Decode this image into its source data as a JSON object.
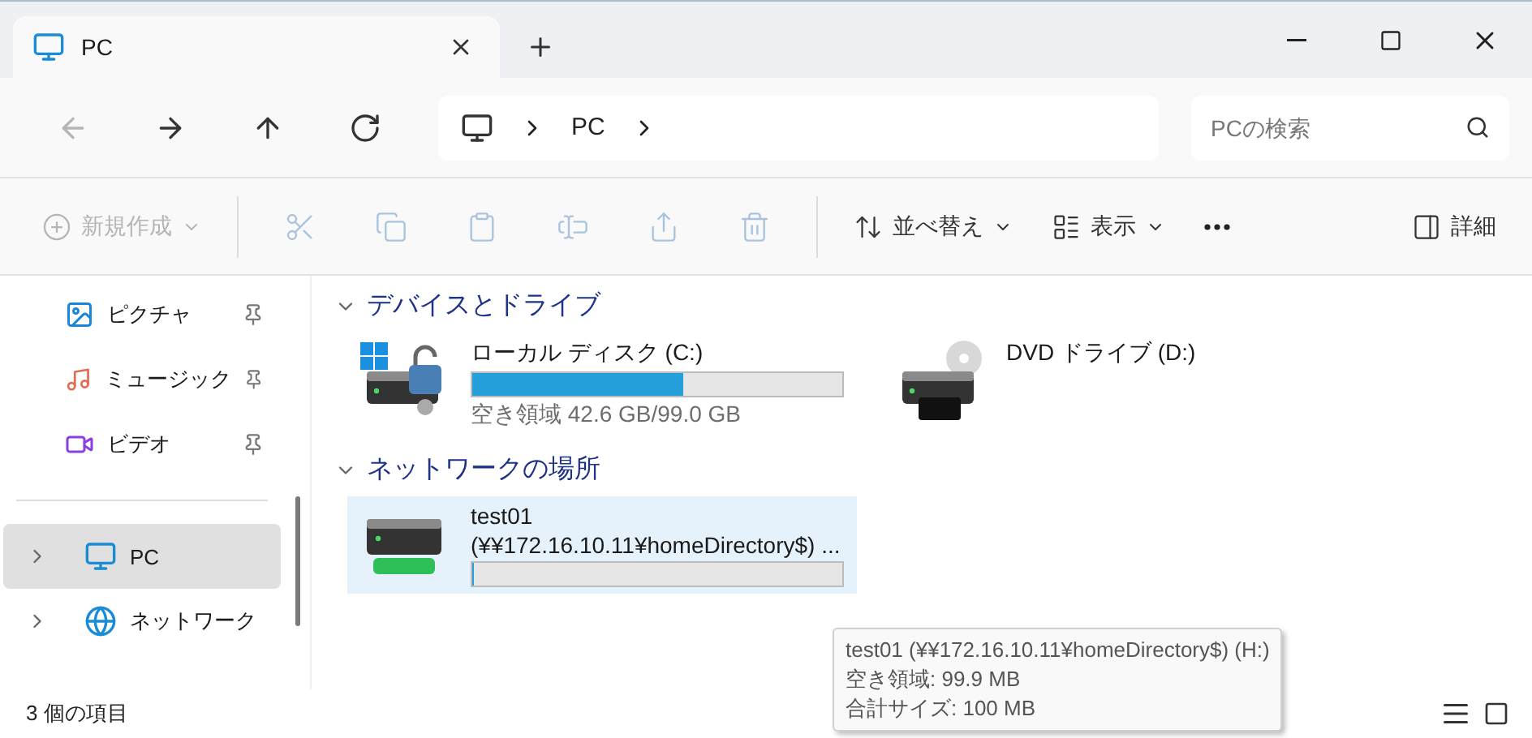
{
  "window": {
    "tab": {
      "title": "PC",
      "selected": true
    }
  },
  "address": {
    "path": [
      "PC"
    ],
    "search": {
      "placeholder": "PCの検索"
    },
    "nav": [
      {
        "disabled": true
      },
      {
        "disabled": false
      },
      {
        "disabled": false
      },
      {
        "disabled": false
      }
    ]
  },
  "toolbar": {
    "items": [
      {
        "kind": "menu",
        "label": "新規作成",
        "disabled": true
      },
      {
        "kind": "separator"
      },
      {
        "kind": "icon",
        "disabled": true
      },
      {
        "kind": "icon",
        "disabled": true
      },
      {
        "kind": "icon",
        "disabled": true
      },
      {
        "kind": "icon",
        "disabled": true
      },
      {
        "kind": "icon",
        "disabled": true
      },
      {
        "kind": "icon",
        "disabled": true
      },
      {
        "kind": "separator"
      },
      {
        "kind": "menu",
        "label": "並べ替え",
        "disabled": false
      },
      {
        "kind": "menu",
        "label": "表示",
        "disabled": false
      },
      {
        "kind": "more",
        "disabled": false
      }
    ],
    "details": {
      "label": "詳細"
    }
  },
  "sidebar": {
    "items": [
      {
        "kind": "pinned",
        "label": "ピクチャ",
        "selected": false
      },
      {
        "kind": "pinned",
        "label": "ミュージック",
        "selected": false
      },
      {
        "kind": "pinned",
        "label": "ビデオ",
        "selected": false
      },
      {
        "kind": "divider"
      },
      {
        "kind": "expandable",
        "label": "PC",
        "selected": true
      },
      {
        "kind": "expandable",
        "label": "ネットワーク",
        "selected": false
      }
    ]
  },
  "sections": [
    {
      "title": "デバイスとドライブ",
      "expanded": true,
      "items": [
        {
          "kind": "disk",
          "name": "ローカル ディスク (C:)",
          "level": 0.57,
          "detail": "空き領域 42.6 GB/99.0 GB",
          "selected": false
        },
        {
          "kind": "dvd",
          "name": "DVD ドライブ (D:)",
          "selected": false
        }
      ]
    },
    {
      "title": "ネットワークの場所",
      "expanded": true,
      "items": [
        {
          "kind": "network",
          "name": "test01",
          "name_line_2": "(¥¥172.16.10.11¥homeDirectory$) ...",
          "level": 0.001,
          "selected": true
        }
      ]
    }
  ],
  "tooltip": [
    "test01 (¥¥172.16.10.11¥homeDirectory$) (H:)",
    "空き領域: 99.9 MB",
    "合計サイズ: 100 MB"
  ],
  "status_bar": {
    "count": "3 個の項目"
  }
}
